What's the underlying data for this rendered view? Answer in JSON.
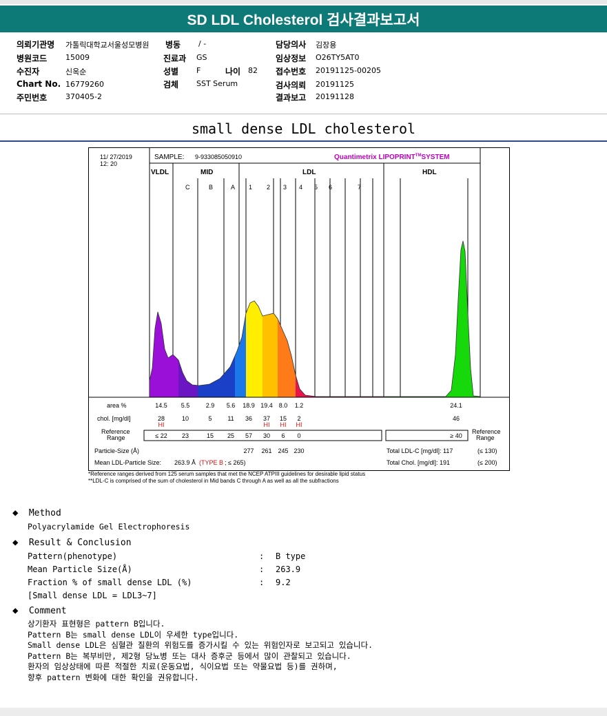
{
  "banner": {
    "title": "SD LDL Cholesterol 검사결과보고서"
  },
  "info": {
    "labels": {
      "institution": "의뢰기관명",
      "hospital_code": "병원코드",
      "patient": "수진자",
      "chart_no": "Chart No.",
      "resident_no": "주민번호",
      "ward": "병동",
      "dept": "진료과",
      "sex": "성별",
      "age": "나이",
      "specimen": "검체",
      "doctor": "담당의사",
      "clinical_info": "임상정보",
      "receipt_no": "접수번호",
      "test_request": "검사의뢰",
      "result_report": "결과보고"
    },
    "values": {
      "institution": "가톨릭대학교서울성모병원",
      "hospital_code": "15009",
      "patient": "신옥순",
      "chart_no": "16779260",
      "resident_no": "370405-2",
      "ward": "/ -",
      "dept": "GS",
      "sex": "F",
      "age": "82",
      "specimen": "SST Serum",
      "doctor": "김장용",
      "clinical_info": "O26TY5AT0",
      "receipt_no": "20191125-00205",
      "test_request": "20191125",
      "result_report": "20191128"
    }
  },
  "subtitle": "small dense LDL cholesterol",
  "report": {
    "date": "11/ 27/2019",
    "time": "12: 20",
    "sample_label": "SAMPLE:",
    "sample_id": "9-933085050910",
    "system_name": "Quantimetrix LIPOPRINT",
    "system_tm": "TM",
    "system_suffix": "SYSTEM",
    "group_vldl": "VLDL",
    "group_mid": "MID",
    "group_ldl": "LDL",
    "group_hdl": "HDL",
    "bands": [
      "C",
      "B",
      "A",
      "1",
      "2",
      "3",
      "4",
      "5",
      "6",
      "7"
    ],
    "row_labels": {
      "area": "area %",
      "chol": "chol. [mg/dl]",
      "ref1": "Reference",
      "ref2": "Range",
      "particle": "Particle-Size (Å)",
      "mean": "Mean LDL-Particle Size:",
      "ref_right1": "Reference",
      "ref_right2": "Range"
    },
    "area": [
      "14.5",
      "5.5",
      "2.9",
      "5.6",
      "18.9",
      "19.4",
      "8.0",
      "1.2",
      "24.1"
    ],
    "chol": [
      "28",
      "10",
      "5",
      "11",
      "36",
      "37",
      "15",
      "2",
      "46"
    ],
    "hi": [
      "HI",
      "HI",
      "HI",
      "HI"
    ],
    "ref": [
      "≤ 22",
      "23",
      "15",
      "25",
      "57",
      "30",
      "6",
      "0",
      "≥ 40"
    ],
    "particle": [
      "277",
      "261",
      "245",
      "230"
    ],
    "mean_value": "263.9 Å",
    "mean_type": "(TYPE B",
    "mean_suffix": "; ≤ 265)",
    "total_ldl": "Total LDL-C [mg/dl]:  117",
    "total_ldl_ref": "(≤ 130)",
    "total_chol": "Total Chol. [mg/dl]:  191",
    "total_chol_ref": "(≤ 200)",
    "footnote1": "*Reference ranges derived from 125 serum samples that met the NCEP ATPIII guidelines for desirable lipid status",
    "footnote2": "**LDL-C is comprised of the sum of cholesterol in Mid bands C through A as well as all the subfractions"
  },
  "chart_data": {
    "type": "area",
    "title": "",
    "xlabel": "",
    "ylabel": "",
    "categories": [
      "VLDL",
      "MID C",
      "MID B",
      "MID A",
      "LDL1",
      "LDL2",
      "LDL3",
      "LDL4",
      "LDL5",
      "LDL6",
      "LDL7",
      "HDL"
    ],
    "area_percent": [
      14.5,
      5.5,
      2.9,
      5.6,
      18.9,
      19.4,
      8.0,
      1.2,
      null,
      null,
      null,
      24.1
    ],
    "colors": [
      "#9a10d8",
      "#6a16c2",
      "#1a40c8",
      "#1a78e8",
      "#ffee00",
      "#ffc000",
      "#ff7a18",
      "#e8144a",
      "#ff0080",
      "#ff0080",
      "#ff0080",
      "#16d80a"
    ]
  },
  "sections": {
    "method_title": "Method",
    "method_text": "Polyacrylamide Gel Electrophoresis",
    "result_title": "Result & Conclusion",
    "result_rows": [
      {
        "k": "Pattern(phenotype)",
        "v": "B type"
      },
      {
        "k": "Mean Particle Size(Å)",
        "v": "263.9"
      },
      {
        "k": "Fraction % of small dense LDL (%)",
        "v": "9.2"
      }
    ],
    "result_note": "[Small dense LDL = LDL3~7]",
    "colon": ":",
    "comment_title": "Comment",
    "comment_lines": [
      "상기환자 표현형은 pattern B입니다.",
      "Pattern B는 small dense LDL이 우세한 type입니다.",
      "Small dense LDL은 심혈관 질환의 위험도를 증가시킬 수 있는 위험인자로 보고되고 있습니다.",
      "Pattern B는 복부비만, 제2형 당뇨병 또는 대사 증후군 등에서 많이 관찰되고 있습니다.",
      "환자의 임상상태에 따른 적절한 치료(운동요법, 식이요법 또는 약물요법 등)를 권하며,",
      "향후 pattern 변화에 대한 확인을 권유합니다."
    ]
  }
}
